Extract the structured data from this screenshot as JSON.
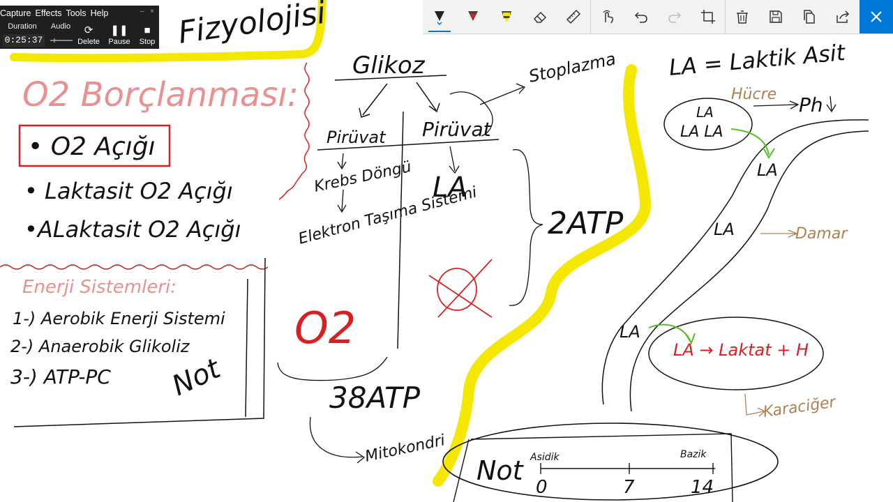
{
  "recorder": {
    "menu": [
      "Capture",
      "Effects",
      "Tools",
      "Help"
    ],
    "duration_label": "Duration",
    "audio_label": "Audio",
    "duration_value": "0:25:37",
    "buttons": [
      {
        "label": "Delete",
        "icon": "refresh-icon"
      },
      {
        "label": "Pause",
        "icon": "pause-icon"
      },
      {
        "label": "Stop",
        "icon": "stop-icon"
      }
    ]
  },
  "ink_toolbar": {
    "tools": [
      "ballpoint-pen-icon",
      "pencil-icon",
      "highlighter-icon",
      "eraser-icon",
      "ruler-icon",
      "touch-writing-icon",
      "undo-icon",
      "redo-icon",
      "crop-icon",
      "delete-icon",
      "save-icon",
      "copy-icon",
      "share-icon",
      "close-icon"
    ],
    "accent": "#0078d7"
  },
  "notes": {
    "title_fragment": "Fizyolojisi",
    "o2_heading": "O2 Borçlanması:",
    "o2_items": [
      "O2 Açığı",
      "Laktasit O2 Açığı",
      "ALaktasit O2 Açığı"
    ],
    "energy_heading": "Enerji Sistemleri:",
    "energy_items": [
      "1-) Aerobik Enerji Sistemi",
      "2-) Anaerobik Glikoliz",
      "3-) ATP-PC"
    ],
    "not_left": "Not",
    "glikoz": "Glikoz",
    "stoplazma": "Stoplazma",
    "piruvat_left": "Pirüvat",
    "piruvat_right": "Pirüvat",
    "krebs": "Krebs Döngü",
    "elektron": "Elektron Taşıma Sistemi",
    "la_middle": "LA",
    "o2_middle": "O2",
    "atp38": "38ATP",
    "atp2": "2ATP",
    "mitokondri": "Mitokondri",
    "la_def": "LA = Laktik Asit",
    "hucre": "Hücre",
    "ph": "Ph",
    "la_labels": [
      "LA",
      "LA LA",
      "LA",
      "LA",
      "LA"
    ],
    "damar": "Damar",
    "laktat": "LA → Laktat + H",
    "karaciger": "Karaciğer",
    "ph_scale": {
      "not": "Not",
      "asidik": "Asidik",
      "bazik": "Bazik",
      "ticks": [
        "0",
        "7",
        "14"
      ]
    }
  },
  "colors": {
    "ink_black": "#111111",
    "ink_red": "#d92020",
    "ink_pink": "#e99090",
    "ink_brown": "#b08050",
    "ink_green": "#55c020",
    "highlight_yellow": "#f5e800"
  }
}
